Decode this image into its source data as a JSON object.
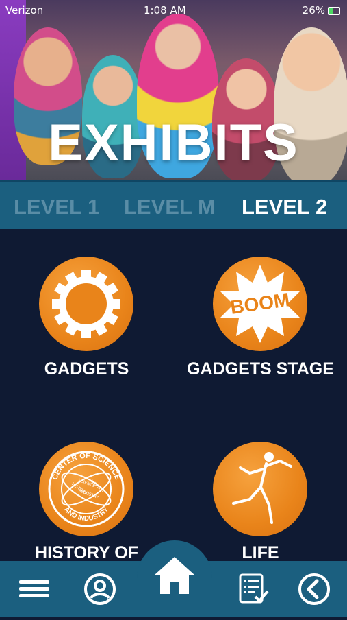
{
  "status_bar": {
    "carrier": "Verizon",
    "time": "1:08 AM",
    "battery": "26%"
  },
  "hero": {
    "title": "EXHIBITS"
  },
  "tabs": [
    {
      "label": "LEVEL 1",
      "selected": false
    },
    {
      "label": "LEVEL M",
      "selected": false
    },
    {
      "label": "LEVEL 2",
      "selected": true
    }
  ],
  "exhibits": [
    {
      "label": "GADGETS",
      "icon": "gear-icon"
    },
    {
      "label": "GADGETS STAGE",
      "icon": "boom-icon"
    },
    {
      "label": "HISTORY OF",
      "icon": "center-of-science-seal-icon",
      "seal_text": {
        "outer_top": "CENTER OF SCIENCE",
        "outer_bottom": "AND INDUSTRY",
        "inner": [
          "HISTORY",
          "SCIENCE",
          "INDUSTRY",
          "HEALTH"
        ]
      }
    },
    {
      "label": "LIFE",
      "icon": "running-figure-icon"
    }
  ],
  "boom_text": "BOOM",
  "nav": {
    "items": [
      "menu-icon",
      "profile-icon",
      "home-icon",
      "checklist-icon",
      "back-icon"
    ]
  },
  "colors": {
    "background": "#0f1a33",
    "bar": "#1b5f7f",
    "accent_orange": "#e9841a",
    "tab_inactive": "#5a8da6",
    "tab_active": "#ffffff"
  }
}
